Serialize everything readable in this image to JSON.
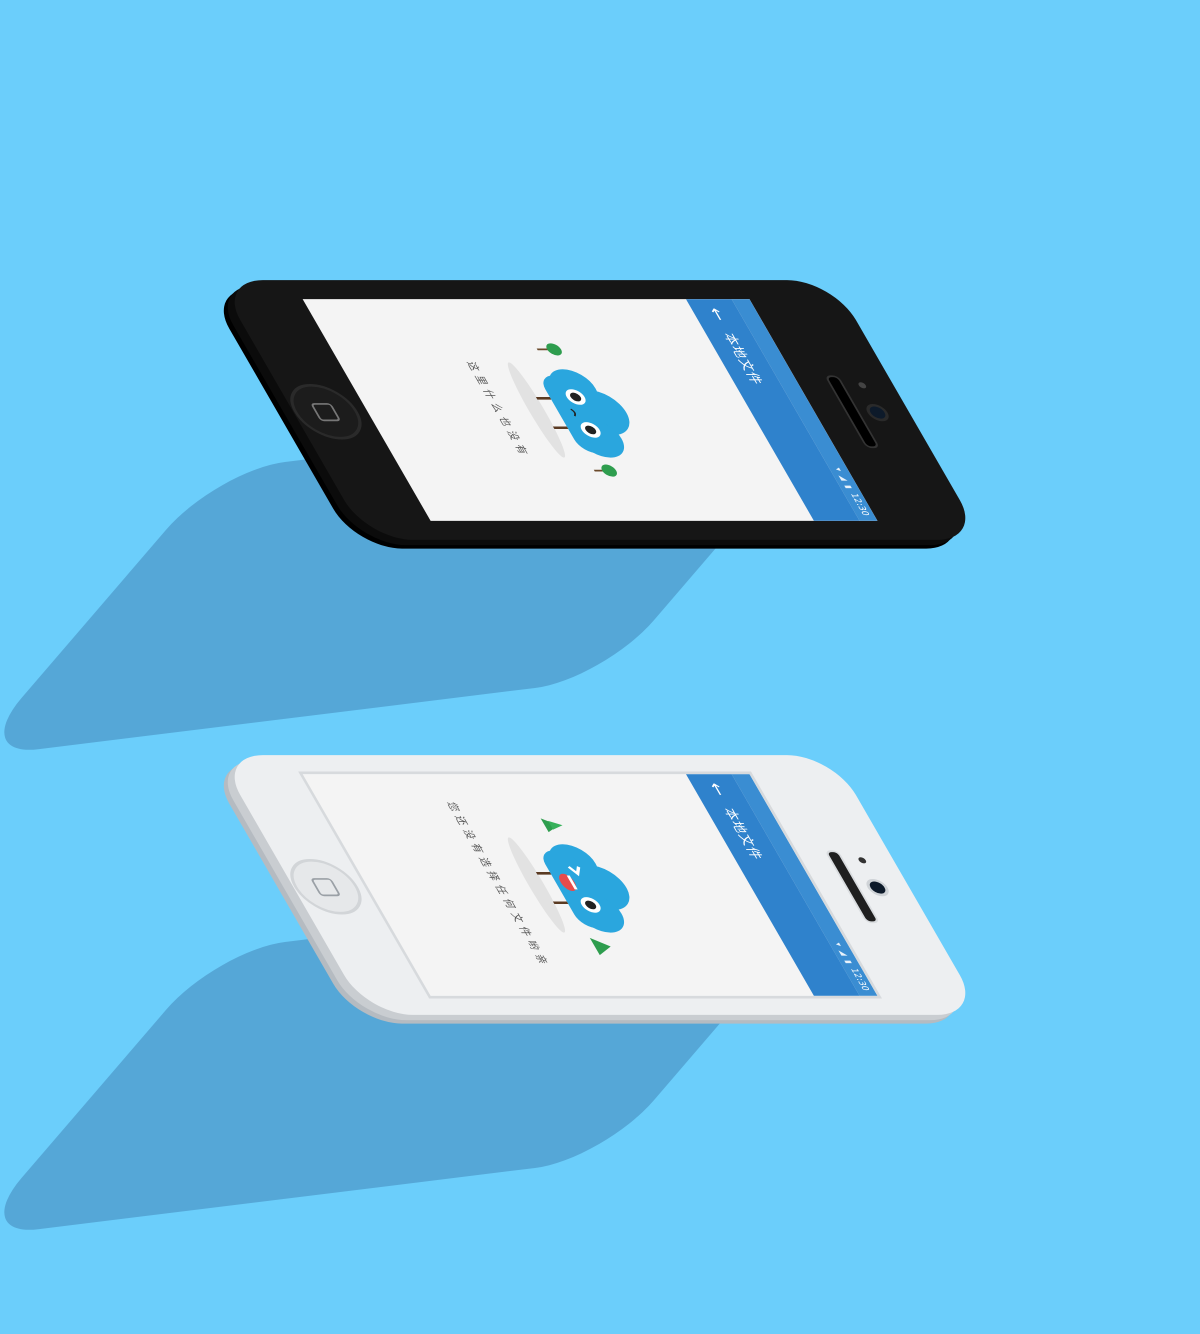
{
  "background_color": "#6BCEFB",
  "phones": [
    {
      "finish": "black",
      "status_bar": {
        "time": "12:30",
        "icons": [
          "wifi-icon",
          "signal-icon",
          "battery-icon"
        ]
      },
      "app_bar": {
        "back_icon": "arrow-left-icon",
        "title": "本地文件"
      },
      "empty_state": {
        "illustration": "sad-cloud-character",
        "message": "这里什么也没有"
      }
    },
    {
      "finish": "white",
      "status_bar": {
        "time": "12:30",
        "icons": [
          "wifi-icon",
          "signal-icon",
          "battery-icon"
        ]
      },
      "app_bar": {
        "back_icon": "arrow-left-icon",
        "title": "本地文件"
      },
      "empty_state": {
        "illustration": "laughing-cloud-character",
        "message": "您还没有选择任何文件哟亲"
      }
    }
  ],
  "colors": {
    "app_bar": "#2F82CC",
    "status_bar": "#3A8DD2",
    "cloud": "#2AA6DE",
    "tree": "#2E9D4E",
    "screen_bg": "#F4F4F4"
  }
}
